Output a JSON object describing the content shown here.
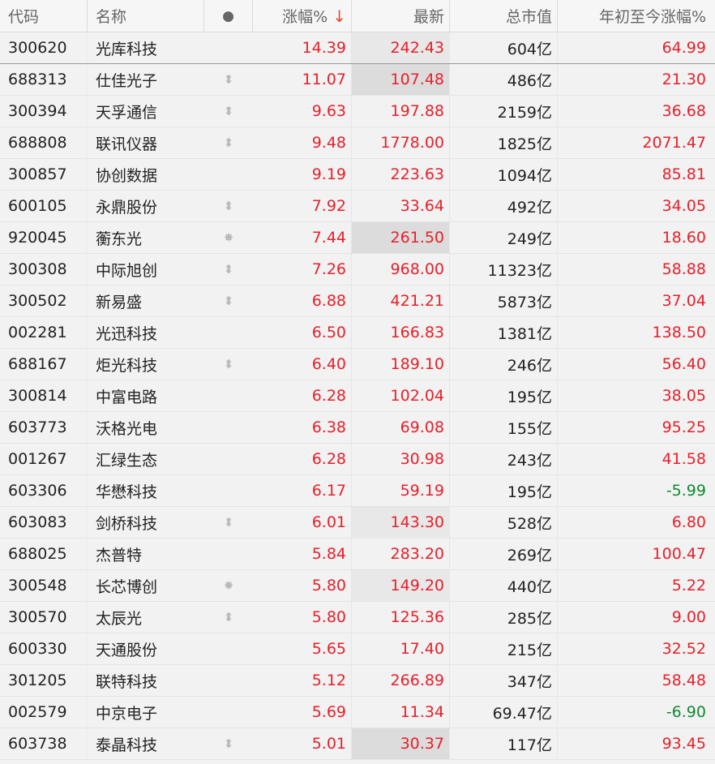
{
  "header": {
    "code": "代码",
    "name": "名称",
    "dot": "●",
    "change": "涨幅%",
    "sort_arrow": "↓",
    "last": "最新",
    "cap": "总市值",
    "ytd": "年初至今涨幅%"
  },
  "colors": {
    "up": "#e8202b",
    "down": "#0f8a2f",
    "sort_arrow": "#e84c2a"
  },
  "rows": [
    {
      "code": "300620",
      "name": "光库科技",
      "icon": "",
      "change": "14.39",
      "last": "242.43",
      "cap": "604亿",
      "ytd": "64.99",
      "ytd_dir": "up",
      "hl": "hl2"
    },
    {
      "code": "688313",
      "name": "仕佳光子",
      "icon": "updown-icon",
      "change": "11.07",
      "last": "107.48",
      "cap": "486亿",
      "ytd": "21.30",
      "ytd_dir": "up",
      "hl": "hl"
    },
    {
      "code": "300394",
      "name": "天孚通信",
      "icon": "updown-icon",
      "change": "9.63",
      "last": "197.88",
      "cap": "2159亿",
      "ytd": "36.68",
      "ytd_dir": "up",
      "hl": ""
    },
    {
      "code": "688808",
      "name": "联讯仪器",
      "icon": "updown-icon",
      "change": "9.48",
      "last": "1778.00",
      "cap": "1825亿",
      "ytd": "2071.47",
      "ytd_dir": "up",
      "hl": ""
    },
    {
      "code": "300857",
      "name": "协创数据",
      "icon": "",
      "change": "9.19",
      "last": "223.63",
      "cap": "1094亿",
      "ytd": "85.81",
      "ytd_dir": "up",
      "hl": ""
    },
    {
      "code": "600105",
      "name": "永鼎股份",
      "icon": "updown-icon",
      "change": "7.92",
      "last": "33.64",
      "cap": "492亿",
      "ytd": "34.05",
      "ytd_dir": "up",
      "hl": ""
    },
    {
      "code": "920045",
      "name": "蘅东光",
      "icon": "star-icon",
      "change": "7.44",
      "last": "261.50",
      "cap": "249亿",
      "ytd": "18.60",
      "ytd_dir": "up",
      "hl": "hl"
    },
    {
      "code": "300308",
      "name": "中际旭创",
      "icon": "updown-icon",
      "change": "7.26",
      "last": "968.00",
      "cap": "11323亿",
      "ytd": "58.88",
      "ytd_dir": "up",
      "hl": ""
    },
    {
      "code": "300502",
      "name": "新易盛",
      "icon": "updown-icon",
      "change": "6.88",
      "last": "421.21",
      "cap": "5873亿",
      "ytd": "37.04",
      "ytd_dir": "up",
      "hl": ""
    },
    {
      "code": "002281",
      "name": "光迅科技",
      "icon": "",
      "change": "6.50",
      "last": "166.83",
      "cap": "1381亿",
      "ytd": "138.50",
      "ytd_dir": "up",
      "hl": ""
    },
    {
      "code": "688167",
      "name": "炬光科技",
      "icon": "updown-icon",
      "change": "6.40",
      "last": "189.10",
      "cap": "246亿",
      "ytd": "56.40",
      "ytd_dir": "up",
      "hl": ""
    },
    {
      "code": "300814",
      "name": "中富电路",
      "icon": "",
      "change": "6.28",
      "last": "102.04",
      "cap": "195亿",
      "ytd": "38.05",
      "ytd_dir": "up",
      "hl": ""
    },
    {
      "code": "603773",
      "name": "沃格光电",
      "icon": "",
      "change": "6.38",
      "last": "69.08",
      "cap": "155亿",
      "ytd": "95.25",
      "ytd_dir": "up",
      "hl": ""
    },
    {
      "code": "001267",
      "name": "汇绿生态",
      "icon": "",
      "change": "6.28",
      "last": "30.98",
      "cap": "243亿",
      "ytd": "41.58",
      "ytd_dir": "up",
      "hl": ""
    },
    {
      "code": "603306",
      "name": "华懋科技",
      "icon": "",
      "change": "6.17",
      "last": "59.19",
      "cap": "195亿",
      "ytd": "-5.99",
      "ytd_dir": "down",
      "hl": ""
    },
    {
      "code": "603083",
      "name": "剑桥科技",
      "icon": "updown-icon",
      "change": "6.01",
      "last": "143.30",
      "cap": "528亿",
      "ytd": "6.80",
      "ytd_dir": "up",
      "hl": "hl2"
    },
    {
      "code": "688025",
      "name": "杰普特",
      "icon": "",
      "change": "5.84",
      "last": "283.20",
      "cap": "269亿",
      "ytd": "100.47",
      "ytd_dir": "up",
      "hl": ""
    },
    {
      "code": "300548",
      "name": "长芯博创",
      "icon": "star-icon",
      "change": "5.80",
      "last": "149.20",
      "cap": "440亿",
      "ytd": "5.22",
      "ytd_dir": "up",
      "hl": "hl2"
    },
    {
      "code": "300570",
      "name": "太辰光",
      "icon": "updown-icon",
      "change": "5.80",
      "last": "125.36",
      "cap": "285亿",
      "ytd": "9.00",
      "ytd_dir": "up",
      "hl": ""
    },
    {
      "code": "600330",
      "name": "天通股份",
      "icon": "",
      "change": "5.65",
      "last": "17.40",
      "cap": "215亿",
      "ytd": "32.52",
      "ytd_dir": "up",
      "hl": ""
    },
    {
      "code": "301205",
      "name": "联特科技",
      "icon": "",
      "change": "5.12",
      "last": "266.89",
      "cap": "347亿",
      "ytd": "58.48",
      "ytd_dir": "up",
      "hl": ""
    },
    {
      "code": "002579",
      "name": "中京电子",
      "icon": "",
      "change": "5.69",
      "last": "11.34",
      "cap": "69.47亿",
      "ytd": "-6.90",
      "ytd_dir": "down",
      "hl": ""
    },
    {
      "code": "603738",
      "name": "泰晶科技",
      "icon": "updown-icon",
      "change": "5.01",
      "last": "30.37",
      "cap": "117亿",
      "ytd": "93.45",
      "ytd_dir": "up",
      "hl": "hl"
    }
  ]
}
